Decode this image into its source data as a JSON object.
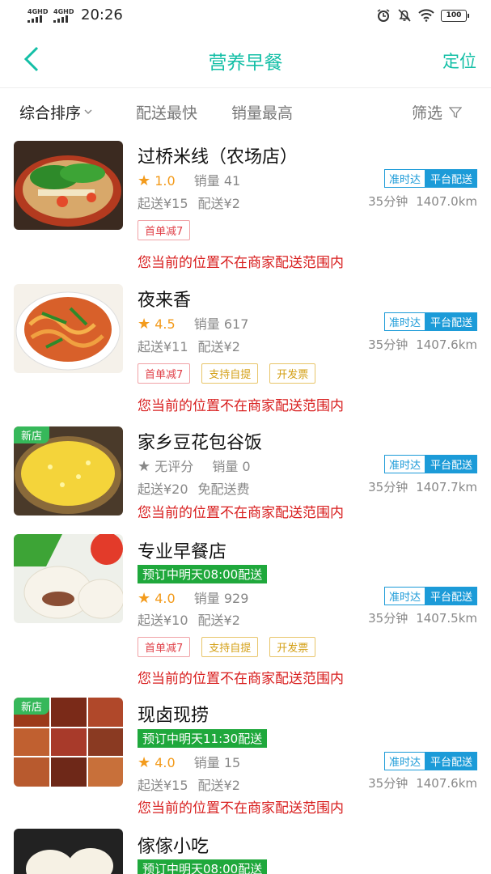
{
  "status_bar": {
    "net1": "4GHD",
    "net2": "4GHD",
    "time": "20:26",
    "battery": "100"
  },
  "header": {
    "title": "营养早餐",
    "right_action": "定位"
  },
  "sort": {
    "items": [
      "综合排序",
      "配送最快",
      "销量最高"
    ],
    "filter": "筛选"
  },
  "colors": {
    "accent": "#13bfa6",
    "warning": "#d81e1e",
    "tag_blue": "#1c9bd8",
    "preorder_green": "#1fa83c"
  },
  "shops": [
    {
      "name": "过桥米线（农场店）",
      "is_new": false,
      "badge_new": "",
      "preorder": "",
      "rating": "1.0",
      "sales": "销量 41",
      "min_order": "起送¥15",
      "delivery_fee": "配送¥2",
      "tag_ontime": "准时达",
      "tag_platform": "平台配送",
      "time": "35分钟",
      "distance": "1407.0km",
      "promos": [
        {
          "text": "首单减7",
          "style": "red"
        }
      ],
      "warning": "您当前的位置不在商家配送范围内"
    },
    {
      "name": "夜来香",
      "is_new": false,
      "badge_new": "",
      "preorder": "",
      "rating": "4.5",
      "sales": "销量 617",
      "min_order": "起送¥11",
      "delivery_fee": "配送¥2",
      "tag_ontime": "准时达",
      "tag_platform": "平台配送",
      "time": "35分钟",
      "distance": "1407.6km",
      "promos": [
        {
          "text": "首单减7",
          "style": "red"
        },
        {
          "text": "支持自提",
          "style": "gold"
        },
        {
          "text": "开发票",
          "style": "gold"
        }
      ],
      "warning": "您当前的位置不在商家配送范围内"
    },
    {
      "name": "家乡豆花包谷饭",
      "is_new": true,
      "badge_new": "新店",
      "preorder": "",
      "rating": "无评分",
      "sales": "销量 0",
      "min_order": "起送¥20",
      "delivery_fee": "免配送费",
      "tag_ontime": "准时达",
      "tag_platform": "平台配送",
      "time": "35分钟",
      "distance": "1407.7km",
      "promos": [],
      "warning": "您当前的位置不在商家配送范围内"
    },
    {
      "name": "专业早餐店",
      "is_new": false,
      "badge_new": "",
      "preorder": "预订中明天08:00配送",
      "rating": "4.0",
      "sales": "销量 929",
      "min_order": "起送¥10",
      "delivery_fee": "配送¥2",
      "tag_ontime": "准时达",
      "tag_platform": "平台配送",
      "time": "35分钟",
      "distance": "1407.5km",
      "promos": [
        {
          "text": "首单减7",
          "style": "red"
        },
        {
          "text": "支持自提",
          "style": "gold"
        },
        {
          "text": "开发票",
          "style": "gold"
        }
      ],
      "warning": "您当前的位置不在商家配送范围内"
    },
    {
      "name": "现卤现捞",
      "is_new": true,
      "badge_new": "新店",
      "preorder": "预订中明天11:30配送",
      "rating": "4.0",
      "sales": "销量 15",
      "min_order": "起送¥15",
      "delivery_fee": "配送¥2",
      "tag_ontime": "准时达",
      "tag_platform": "平台配送",
      "time": "35分钟",
      "distance": "1407.6km",
      "promos": [],
      "warning": "您当前的位置不在商家配送范围内"
    },
    {
      "name": "傢傢小吃",
      "is_new": false,
      "badge_new": "",
      "preorder": "预订中明天08:00配送",
      "rating": "",
      "sales": "",
      "min_order": "",
      "delivery_fee": "",
      "tag_ontime": "",
      "tag_platform": "",
      "time": "",
      "distance": "",
      "promos": [],
      "warning": ""
    }
  ]
}
